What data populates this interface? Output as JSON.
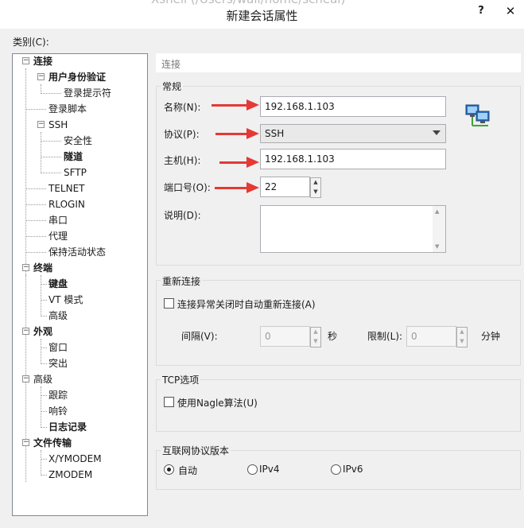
{
  "window": {
    "title": "新建会话属性",
    "ghost_title": "Xshell (/Users/wall/home/scheal)",
    "help": "?",
    "close": "✕"
  },
  "category_label": "类别(C):",
  "tree": [
    {
      "label": "连接",
      "bold": true
    },
    {
      "label": "用户身份验证",
      "bold": true
    },
    {
      "label": "登录提示符",
      "bold": false
    },
    {
      "label": "登录脚本",
      "bold": false
    },
    {
      "label": "SSH",
      "bold": false
    },
    {
      "label": "安全性",
      "bold": false
    },
    {
      "label": "隧道",
      "bold": true
    },
    {
      "label": "SFTP",
      "bold": false
    },
    {
      "label": "TELNET",
      "bold": false
    },
    {
      "label": "RLOGIN",
      "bold": false
    },
    {
      "label": "串口",
      "bold": false
    },
    {
      "label": "代理",
      "bold": false
    },
    {
      "label": "保持活动状态",
      "bold": false
    },
    {
      "label": "终端",
      "bold": true
    },
    {
      "label": "键盘",
      "bold": true
    },
    {
      "label": "VT 模式",
      "bold": false
    },
    {
      "label": "高级",
      "bold": false
    },
    {
      "label": "外观",
      "bold": true
    },
    {
      "label": "窗口",
      "bold": false
    },
    {
      "label": "突出",
      "bold": false
    },
    {
      "label": "高级",
      "bold": false
    },
    {
      "label": "跟踪",
      "bold": false
    },
    {
      "label": "响铃",
      "bold": false
    },
    {
      "label": "日志记录",
      "bold": true
    },
    {
      "label": "文件传输",
      "bold": true
    },
    {
      "label": "X/YMODEM",
      "bold": false
    },
    {
      "label": "ZMODEM",
      "bold": false
    }
  ],
  "header": "连接",
  "general": {
    "title": "常规",
    "name_label": "名称(N):",
    "name_value": "192.168.1.103",
    "protocol_label": "协议(P):",
    "protocol_value": "SSH",
    "host_label": "主机(H):",
    "host_value": "192.168.1.103",
    "port_label": "端口号(O):",
    "port_value": "22",
    "desc_label": "说明(D):",
    "desc_value": ""
  },
  "reconnect": {
    "title": "重新连接",
    "checkbox_label": "连接异常关闭时自动重新连接(A)",
    "interval_label": "间隔(V):",
    "interval_value": "0",
    "interval_unit": "秒",
    "limit_label": "限制(L):",
    "limit_value": "0",
    "limit_unit": "分钟"
  },
  "tcp": {
    "title": "TCP选项",
    "nagle_label": "使用Nagle算法(U)"
  },
  "ip_version": {
    "title": "互联网协议版本",
    "options": [
      "自动",
      "IPv4",
      "IPv6"
    ],
    "selected": "自动"
  },
  "colors": {
    "annotation_arrow": "#e53935"
  }
}
